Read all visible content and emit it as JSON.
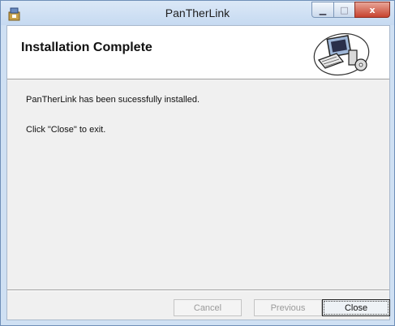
{
  "window": {
    "title": "PanTherLink"
  },
  "titlebar_buttons": {
    "minimize": "▁",
    "maximize": "□",
    "close": "x"
  },
  "banner": {
    "heading": "Installation Complete"
  },
  "body": {
    "line1": "PanTherLink has been sucessfully installed.",
    "line2": "Click \"Close\" to exit."
  },
  "buttons": {
    "cancel": "Cancel",
    "previous": "Previous",
    "close": "Close"
  },
  "colors": {
    "titlebar": "#c6daf1",
    "close_button": "#c7432f",
    "panel": "#f0f0f0"
  }
}
